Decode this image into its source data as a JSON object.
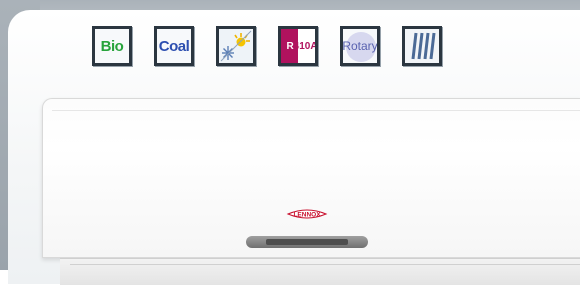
{
  "features": [
    {
      "label": "Bio",
      "icon": "bio-icon"
    },
    {
      "label": "Coal",
      "icon": "coal-icon"
    },
    {
      "label": "",
      "icon": "heat-cool-icon"
    },
    {
      "label": "R410A",
      "icon": "r410a-refrigerant-icon"
    },
    {
      "label": "Rotary",
      "icon": "rotary-compressor-icon"
    },
    {
      "label": "",
      "icon": "filter-icon"
    }
  ],
  "brand": {
    "logo_text": "LENNOX",
    "logo_color": "#c8102e"
  },
  "colors": {
    "icon_border": "#2b3640",
    "bio": "#27a33b",
    "coal": "#2d4fb0",
    "r410a": "#b0125e",
    "rotary": "#5a63b0"
  }
}
